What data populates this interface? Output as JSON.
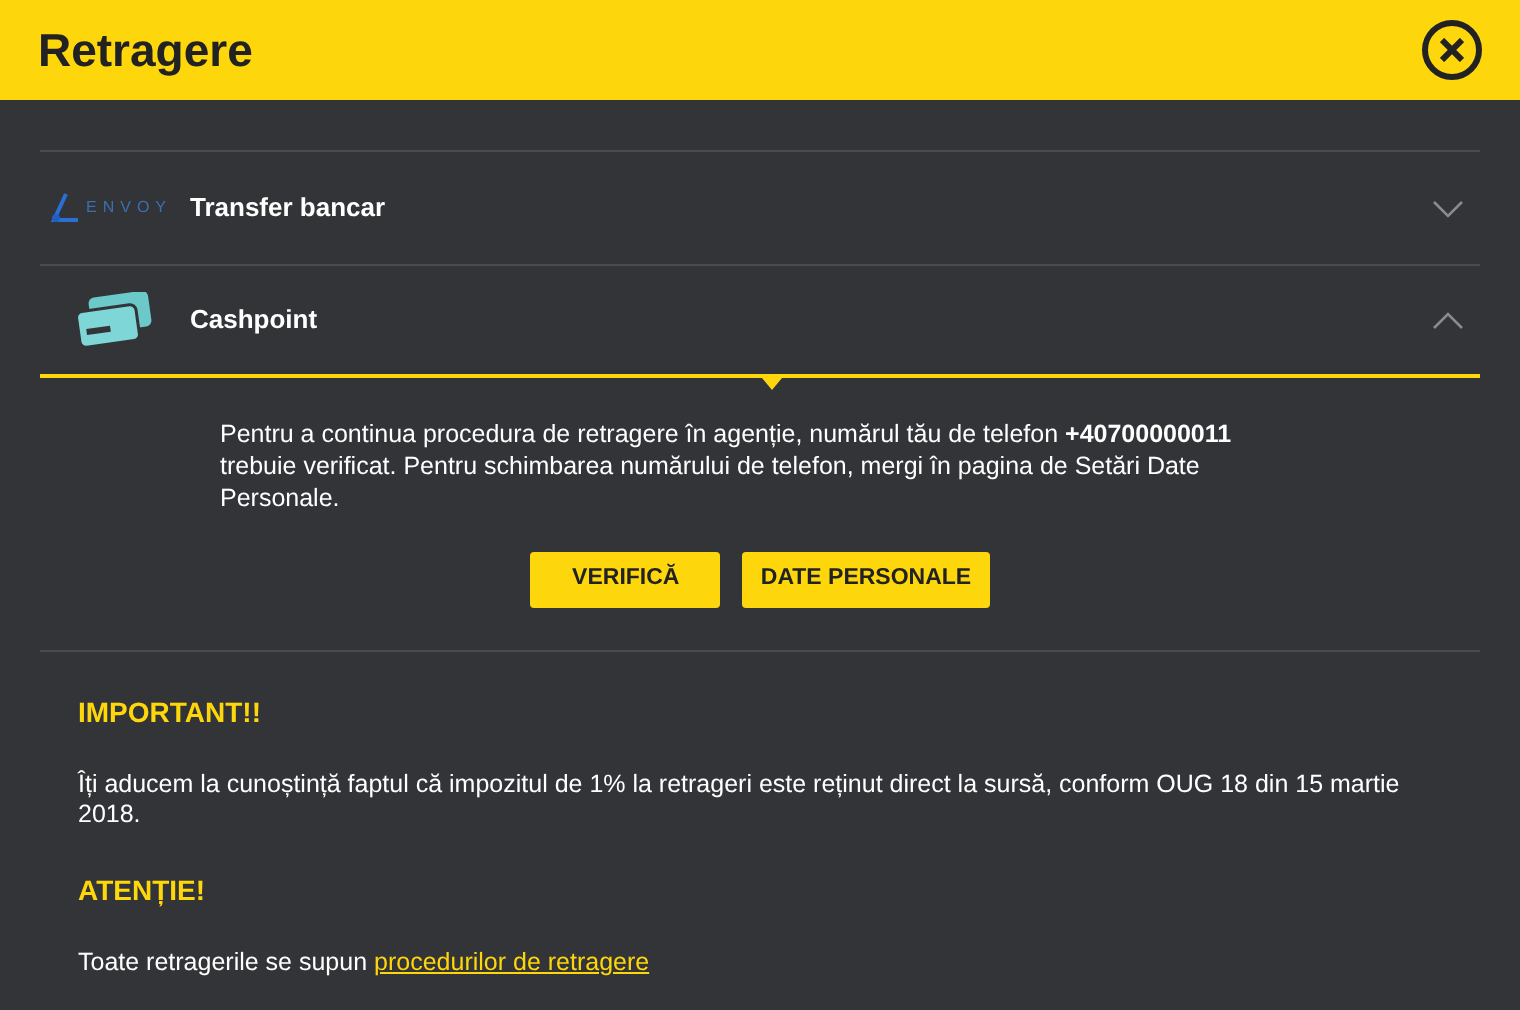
{
  "window": {
    "title": "Retragere"
  },
  "methods": [
    {
      "kind": "envoy",
      "logo_text": "ENVOY",
      "label": "Transfer bancar",
      "expanded": false
    },
    {
      "kind": "cards",
      "label": "Cashpoint",
      "expanded": true,
      "message": "Pentru a continua procedura de retragere în agenție, numărul tău de telefon **+40700000011** trebuie verificat. Pentru schimbarea numărului de telefon, mergi în pagina de Setări Date Personale.",
      "buttons": [
        "VERIFICĂ",
        "DATE PERSONALE"
      ]
    }
  ],
  "notices": [
    {
      "heading": "IMPORTANT!!",
      "text": "Îți aducem la cunoștință faptul că impozitul de 1% la retrageri este reținut direct la sursă, conform OUG 18 din 15 martie 2018."
    },
    {
      "heading": "ATENȚIE!",
      "text": "Toate retragerile se supun",
      "link": "procedurilor de retragere"
    }
  ]
}
